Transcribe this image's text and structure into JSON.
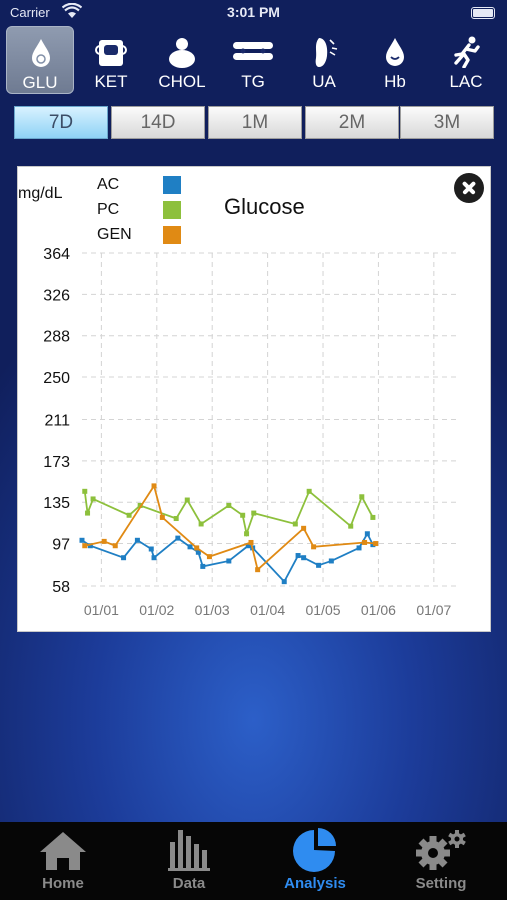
{
  "status_bar": {
    "carrier": "Carrier",
    "time": "3:01 PM"
  },
  "test_tabs": [
    {
      "label": "GLU",
      "icon": "glucose-drop-icon",
      "active": true
    },
    {
      "label": "KET",
      "icon": "ketone-icon",
      "active": false
    },
    {
      "label": "CHOL",
      "icon": "cholesterol-person-icon",
      "active": false
    },
    {
      "label": "TG",
      "icon": "triglyceride-chain-icon",
      "active": false
    },
    {
      "label": "UA",
      "icon": "uric-acid-foot-icon",
      "active": false
    },
    {
      "label": "Hb",
      "icon": "hemoglobin-drop-icon",
      "active": false
    },
    {
      "label": "LAC",
      "icon": "lactate-runner-icon",
      "active": false
    }
  ],
  "range_tabs": [
    {
      "label": "7D",
      "active": true
    },
    {
      "label": "14D",
      "active": false
    },
    {
      "label": "1M",
      "active": false
    },
    {
      "label": "2M",
      "active": false
    },
    {
      "label": "3M",
      "active": false
    }
  ],
  "chart_data": {
    "type": "line",
    "title": "Glucose",
    "ylabel": "mg/dL",
    "xlabel": "",
    "y_ticks": [
      58,
      97,
      135,
      173,
      211,
      250,
      288,
      326,
      364
    ],
    "ylim": [
      58,
      364
    ],
    "x_ticks": [
      "01/01",
      "01/02",
      "01/03",
      "01/04",
      "01/05",
      "01/06",
      "01/07"
    ],
    "xlim": [
      -0.35,
      6.4
    ],
    "grid": true,
    "legend_position": "top-left",
    "series": [
      {
        "name": "AC",
        "color": "#1f7fc4",
        "x": [
          -0.35,
          -0.2,
          0.4,
          0.65,
          0.9,
          0.95,
          1.38,
          1.6,
          1.75,
          1.83,
          2.3,
          2.65,
          2.73,
          3.3,
          3.55,
          3.65,
          3.92,
          4.15,
          4.65,
          4.8,
          4.9
        ],
        "y": [
          100,
          95,
          84,
          100,
          92,
          84,
          102,
          94,
          89,
          76,
          81,
          95,
          93,
          62,
          86,
          84,
          77,
          81,
          93,
          106,
          96
        ]
      },
      {
        "name": "PC",
        "color": "#8dc03c",
        "x": [
          -0.3,
          -0.25,
          -0.15,
          0.5,
          0.7,
          1.35,
          1.55,
          1.8,
          2.3,
          2.55,
          2.62,
          2.75,
          3.5,
          3.75,
          4.5,
          4.7,
          4.9
        ],
        "y": [
          145,
          125,
          138,
          123,
          132,
          120,
          137,
          115,
          132,
          123,
          106,
          125,
          115,
          145,
          113,
          140,
          121
        ]
      },
      {
        "name": "GEN",
        "color": "#e08a14",
        "x": [
          -0.3,
          0.05,
          0.25,
          0.95,
          1.1,
          1.72,
          1.95,
          2.7,
          2.82,
          3.65,
          3.83,
          4.75,
          4.95
        ],
        "y": [
          95,
          99,
          95,
          150,
          121,
          93,
          85,
          98,
          73,
          111,
          94,
          98,
          97
        ]
      }
    ]
  },
  "nav": [
    {
      "label": "Home",
      "icon": "home-icon",
      "active": false
    },
    {
      "label": "Data",
      "icon": "bar-chart-icon",
      "active": false
    },
    {
      "label": "Analysis",
      "icon": "pie-chart-icon",
      "active": true
    },
    {
      "label": "Setting",
      "icon": "gear-icon",
      "active": false
    }
  ],
  "colors": {
    "accent": "#2f8cf0",
    "active_range": "#8fd2f5"
  }
}
